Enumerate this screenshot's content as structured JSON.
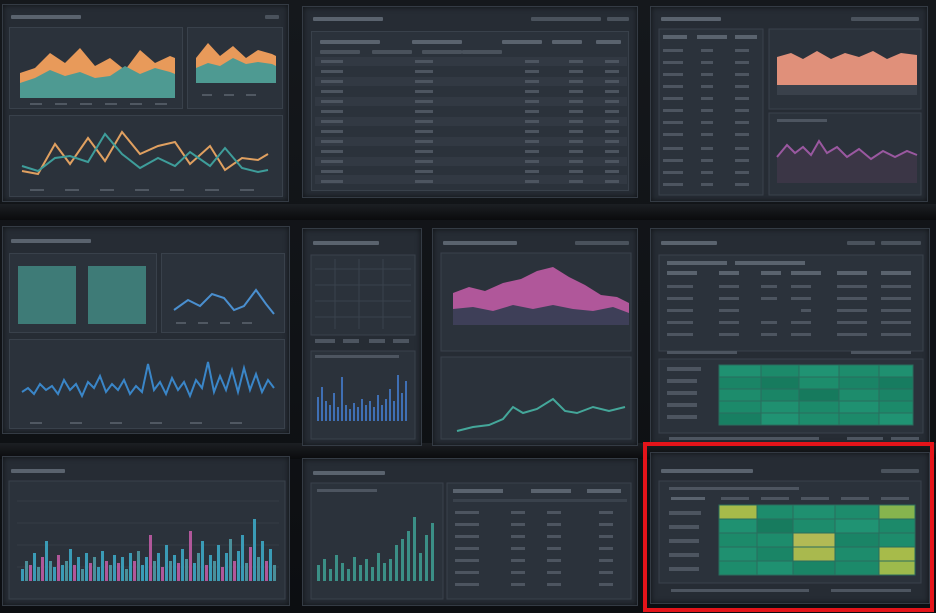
{
  "screen": {
    "description_free": true
  },
  "colors": {
    "panel_bg": "#262c34",
    "orange": "#e89a5a",
    "teal": "#4e9a92",
    "salmon": "#e0907a",
    "purple": "#8a4f8c",
    "magenta": "#b0579a",
    "blue": "#3f86c4",
    "green_heat": "#1e8f6c",
    "yellow_heat": "#a7bb4a",
    "highlight": "#e4141a"
  },
  "heatmap_mid": {
    "rows": 5,
    "cols": 5,
    "cells": [
      [
        "g",
        "g",
        "g",
        "g",
        "g"
      ],
      [
        "g",
        "d",
        "g",
        "g",
        "d"
      ],
      [
        "g",
        "g",
        "d",
        "g",
        "g"
      ],
      [
        "g",
        "g",
        "g",
        "g",
        "g"
      ],
      [
        "d",
        "g",
        "g",
        "g",
        "g"
      ]
    ]
  },
  "heatmap_highlighted": {
    "rows": 5,
    "cols": 5,
    "cells": [
      [
        "y",
        "g",
        "g",
        "g",
        "y"
      ],
      [
        "g",
        "d",
        "g",
        "g",
        "g"
      ],
      [
        "g",
        "g",
        "y",
        "g",
        "g"
      ],
      [
        "g",
        "g",
        "y",
        "g",
        "y"
      ],
      [
        "g",
        "g",
        "g",
        "g",
        "y"
      ]
    ]
  },
  "selection": {
    "label": ""
  }
}
